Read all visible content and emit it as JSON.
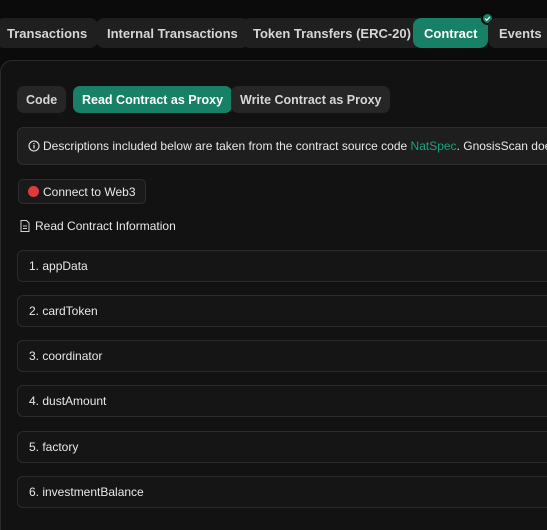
{
  "tabs": [
    {
      "label": "Transactions"
    },
    {
      "label": "Internal Transactions"
    },
    {
      "label": "Token Transfers (ERC-20)"
    },
    {
      "label": "Contract",
      "active": true,
      "verified": true
    },
    {
      "label": "Events"
    }
  ],
  "subtabs": [
    {
      "label": "Code"
    },
    {
      "label": "Read Contract as Proxy",
      "active": true
    },
    {
      "label": "Write Contract as Proxy"
    }
  ],
  "notice": {
    "icon": "info-circle-icon",
    "text_before": "Descriptions included below are taken from the contract source code ",
    "link": "NatSpec",
    "text_after": ". GnosisScan doe"
  },
  "connect": {
    "label": "Connect to Web3",
    "status_color": "#e03a3e"
  },
  "section": {
    "icon": "document-icon",
    "title": "Read Contract Information"
  },
  "functions": [
    "1. appData",
    "2. cardToken",
    "3. coordinator",
    "4. dustAmount",
    "5. factory",
    "6. investmentBalance"
  ],
  "colors": {
    "accent": "#178066",
    "link": "#1aa37c",
    "background": "#0b0b0b"
  }
}
